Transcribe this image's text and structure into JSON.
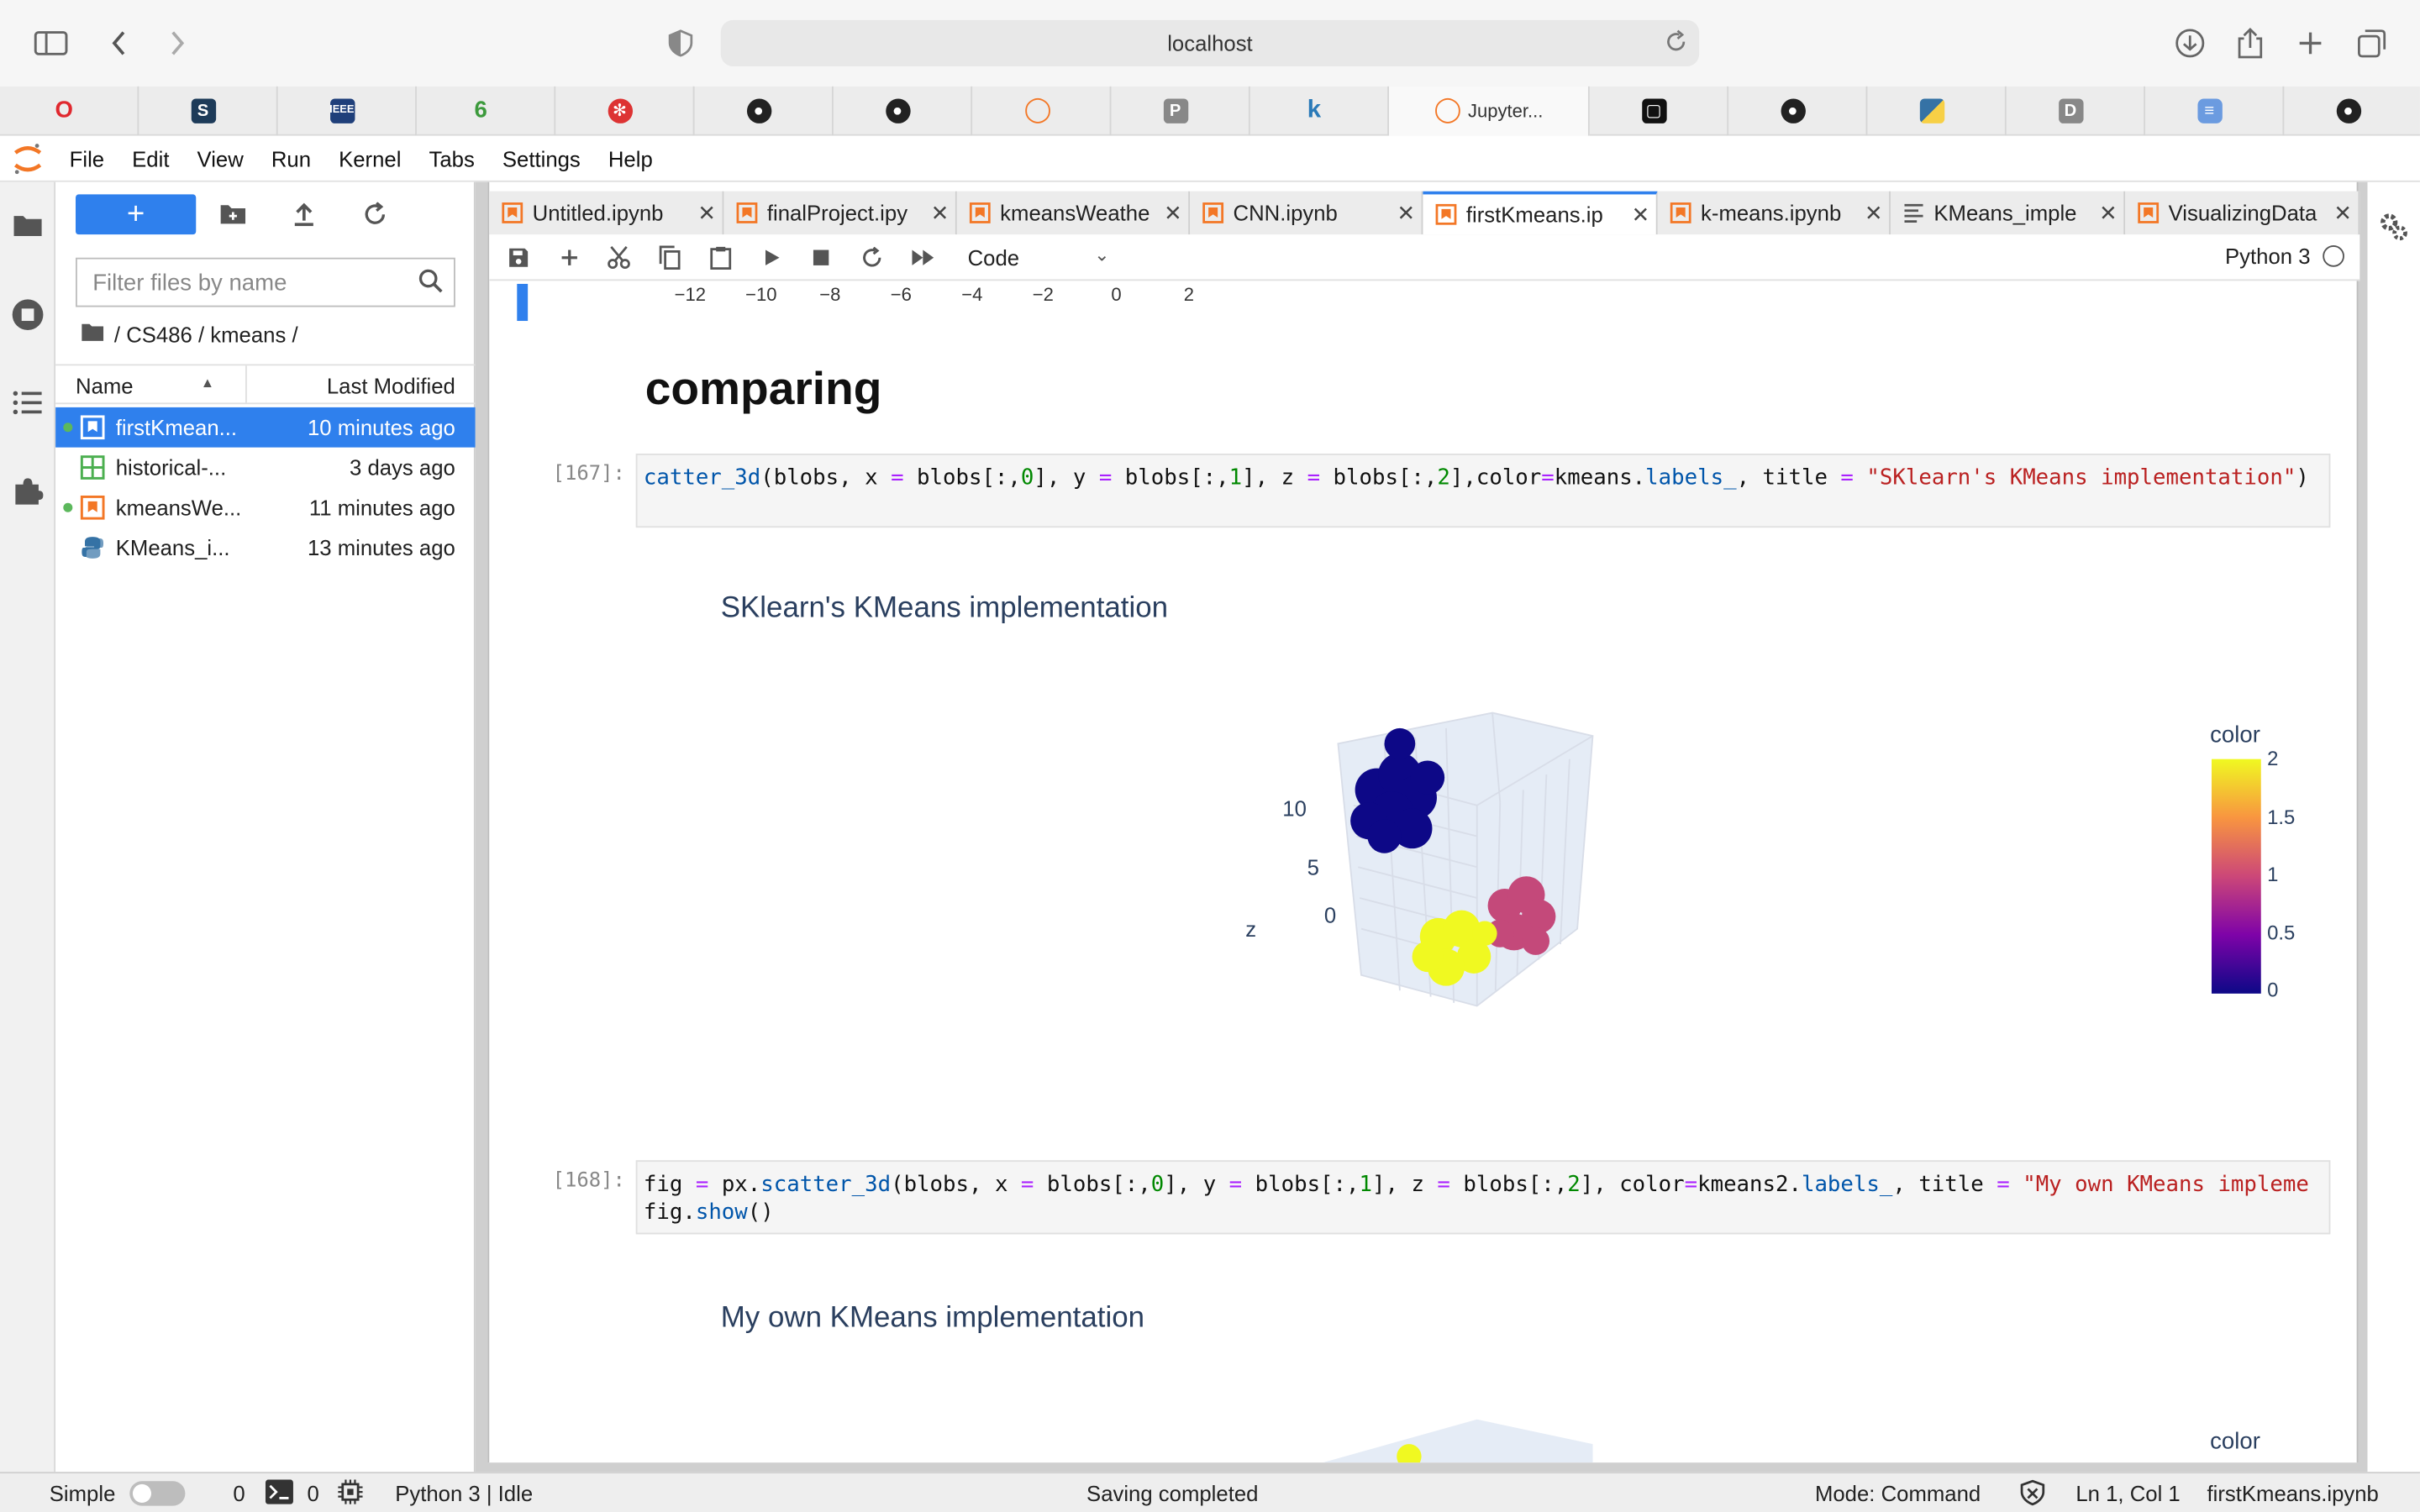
{
  "browser": {
    "url": "localhost",
    "active_tab_label": "Jupyter...",
    "favicons": [
      "opera-icon",
      "notion-icon",
      "ieee-icon",
      "leaf-icon",
      "gear-red-icon",
      "github-icon",
      "github-icon",
      "jupyter-icon",
      "p-icon",
      "k-icon",
      "jupyter-icon",
      "box-icon",
      "github-icon",
      "python-icon",
      "d-icon",
      "database-icon",
      "github-icon"
    ]
  },
  "menu": {
    "items": [
      "File",
      "Edit",
      "View",
      "Run",
      "Kernel",
      "Tabs",
      "Settings",
      "Help"
    ]
  },
  "filebrowser": {
    "new_label": "+",
    "filter_placeholder": "Filter files by name",
    "breadcrumb": "/ CS486 / kmeans /",
    "col_name": "Name",
    "col_modified": "Last Modified",
    "files": [
      {
        "name": "firstKmean...",
        "modified": "10 minutes ago",
        "kind": "notebook",
        "running": true,
        "selected": true
      },
      {
        "name": "historical-...",
        "modified": "3 days ago",
        "kind": "table",
        "running": false,
        "selected": false
      },
      {
        "name": "kmeansWe...",
        "modified": "11 minutes ago",
        "kind": "notebook",
        "running": true,
        "selected": false
      },
      {
        "name": "KMeans_i...",
        "modified": "13 minutes ago",
        "kind": "python",
        "running": false,
        "selected": false
      }
    ]
  },
  "tabs": [
    {
      "label": "Untitled.ipynb",
      "kind": "notebook",
      "active": false
    },
    {
      "label": "finalProject.ipy",
      "kind": "notebook",
      "active": false
    },
    {
      "label": "kmeansWeathe",
      "kind": "notebook",
      "active": false
    },
    {
      "label": "CNN.ipynb",
      "kind": "notebook",
      "active": false
    },
    {
      "label": "firstKmeans.ip",
      "kind": "notebook",
      "active": true
    },
    {
      "label": "k-means.ipynb",
      "kind": "notebook",
      "active": false
    },
    {
      "label": "KMeans_imple",
      "kind": "text",
      "active": false
    },
    {
      "label": "VisualizingData",
      "kind": "notebook",
      "active": false
    }
  ],
  "toolbar": {
    "cell_type": "Code",
    "kernel": "Python 3"
  },
  "notebook": {
    "prev_ticks": [
      "−12",
      "−10",
      "−8",
      "−6",
      "−4",
      "−2",
      "0",
      "2"
    ],
    "heading": "comparing",
    "cell1": {
      "prompt": "[167]:",
      "code": "catter_3d(blobs, x = blobs[:,0], y = blobs[:,1], z = blobs[:,2],color=kmeans.labels_, title = \"SKlearn's KMeans implementation\")"
    },
    "plot1": {
      "title": "SKlearn's KMeans implementation",
      "colorbar_title": "color",
      "colorbar_ticks": [
        "2",
        "1.5",
        "1",
        "0.5",
        "0"
      ],
      "z_label": "z",
      "z_ticks": [
        "10",
        "5",
        "0"
      ]
    },
    "cell2": {
      "prompt": "[168]:",
      "line1": "fig = px.scatter_3d(blobs, x = blobs[:,0], y = blobs[:,1], z = blobs[:,2], color=kmeans2.labels_, title = \"My own KMeans impleme",
      "line2": "fig.show()"
    },
    "plot2": {
      "title": "My own KMeans implementation",
      "colorbar_title": "color"
    }
  },
  "colors": {
    "accent": "#2f80ed",
    "cluster_navy": "#0d0887",
    "cluster_pink": "#c4497a",
    "cluster_yellow": "#f0f921"
  },
  "statusbar": {
    "mode_label": "Simple",
    "terminals": "0",
    "kernels": "0",
    "kernel_status": "Python 3 | Idle",
    "save_status": "Saving completed",
    "mode": "Mode: Command",
    "position": "Ln 1, Col 1",
    "filename": "firstKmeans.ipynb"
  }
}
